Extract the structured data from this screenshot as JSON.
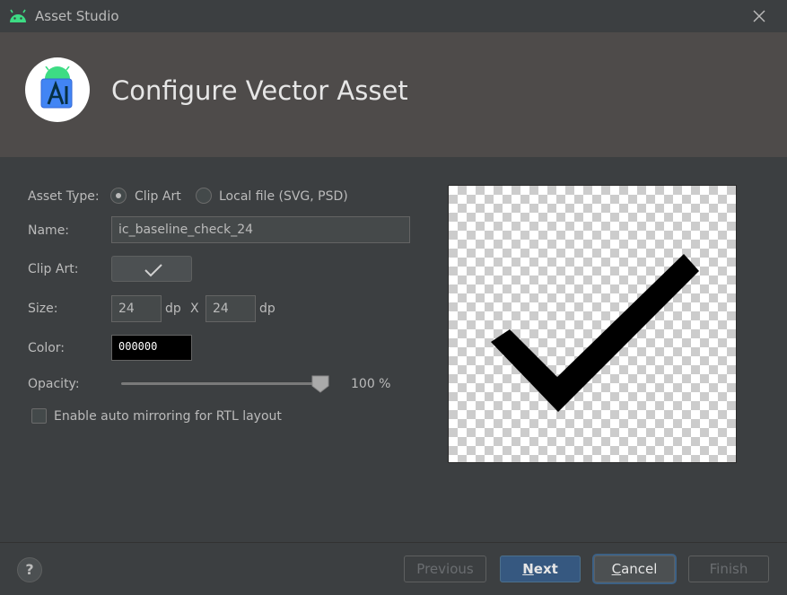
{
  "window": {
    "title": "Asset Studio"
  },
  "header": {
    "heading": "Configure Vector Asset"
  },
  "form": {
    "asset_type_label": "Asset Type:",
    "asset_type_options": [
      {
        "label": "Clip Art",
        "selected": true
      },
      {
        "label": "Local file (SVG, PSD)",
        "selected": false
      }
    ],
    "name_label": "Name:",
    "name_value": "ic_baseline_check_24",
    "clip_art_label": "Clip Art:",
    "clip_art_icon": "check-icon",
    "size_label": "Size:",
    "size_width": "24",
    "size_height": "24",
    "size_unit": "dp",
    "size_separator": "X",
    "color_label": "Color:",
    "color_value": "000000",
    "opacity_label": "Opacity:",
    "opacity_value": 100,
    "opacity_text": "100 %",
    "auto_mirror_label": "Enable auto mirroring for RTL layout",
    "auto_mirror_checked": false
  },
  "preview": {
    "icon": "check-icon",
    "color": "#000000"
  },
  "footer": {
    "help_label": "?",
    "previous_label": "Previous",
    "next_label": "Next",
    "cancel_label": "Cancel",
    "finish_label": "Finish"
  },
  "colors": {
    "background": "#3c3f41",
    "header_background": "#4e4b4a",
    "primary_button": "#365880",
    "android_green": "#3ddc84"
  }
}
